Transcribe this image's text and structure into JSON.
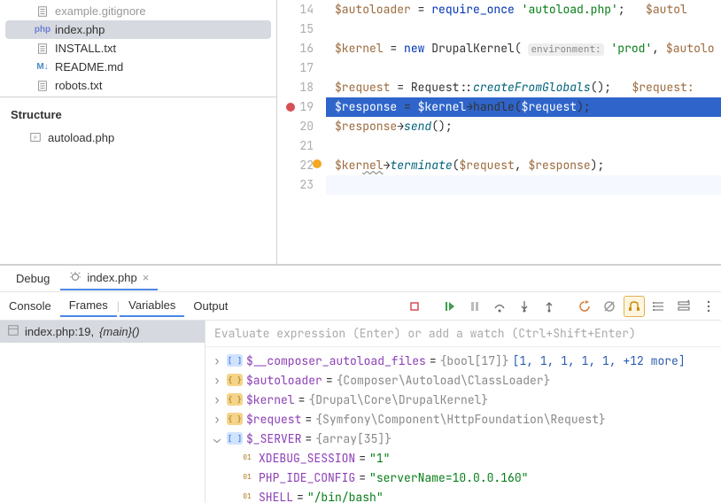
{
  "fileTree": [
    {
      "name": "example.gitignore",
      "type": "txt",
      "dimmed": true
    },
    {
      "name": "index.php",
      "type": "php",
      "selected": true
    },
    {
      "name": "INSTALL.txt",
      "type": "txt"
    },
    {
      "name": "README.md",
      "type": "md"
    },
    {
      "name": "robots.txt",
      "type": "txt"
    }
  ],
  "structure": {
    "title": "Structure",
    "items": [
      "autoload.php"
    ]
  },
  "editor": {
    "startLine": 14,
    "breakpointLine": 19,
    "markerLine": 22,
    "lines": [
      {
        "tokens": [
          [
            "var",
            "$autoloader"
          ],
          [
            "op",
            " = "
          ],
          [
            "kw",
            "require_once"
          ],
          [
            "op",
            " "
          ],
          [
            "str",
            "'autoload.php'"
          ],
          [
            "op",
            ";   "
          ],
          [
            "var",
            "$autol"
          ]
        ]
      },
      {
        "tokens": []
      },
      {
        "tokens": [
          [
            "var",
            "$kernel"
          ],
          [
            "op",
            " = "
          ],
          [
            "kw",
            "new"
          ],
          [
            "op",
            " "
          ],
          [
            "cls",
            "DrupalKernel"
          ],
          [
            "op",
            "( "
          ],
          [
            "hint",
            "environment:"
          ],
          [
            "op",
            " "
          ],
          [
            "str",
            "'prod'"
          ],
          [
            "op",
            ", "
          ],
          [
            "var",
            "$autolo"
          ]
        ]
      },
      {
        "tokens": []
      },
      {
        "tokens": [
          [
            "var",
            "$request"
          ],
          [
            "op",
            " = "
          ],
          [
            "cls",
            "Request"
          ],
          [
            "op",
            "::"
          ],
          [
            "fn",
            "createFromGlobals"
          ],
          [
            "op",
            "();   "
          ],
          [
            "var",
            "$request:"
          ]
        ]
      },
      {
        "highlight": true,
        "tokens": [
          [
            "var",
            "$response"
          ],
          [
            "op",
            " = "
          ],
          [
            "var",
            "$kernel"
          ],
          [
            "op",
            "→"
          ],
          [
            "cls",
            "handle"
          ],
          [
            "op",
            "("
          ],
          [
            "var",
            "$request"
          ],
          [
            "op",
            ");"
          ]
        ]
      },
      {
        "tokens": [
          [
            "var",
            "$response"
          ],
          [
            "op",
            "→"
          ],
          [
            "fn",
            "send"
          ],
          [
            "op",
            "();"
          ]
        ]
      },
      {
        "tokens": []
      },
      {
        "tokens": [
          [
            "var",
            "$ker"
          ],
          [
            "underline",
            "nel"
          ],
          [
            "op",
            "→"
          ],
          [
            "fn",
            "terminate"
          ],
          [
            "op",
            "("
          ],
          [
            "var",
            "$request"
          ],
          [
            "op",
            ", "
          ],
          [
            "var",
            "$response"
          ],
          [
            "op",
            ");"
          ]
        ]
      },
      {
        "current": true,
        "tokens": []
      }
    ]
  },
  "debug": {
    "panelTitle": "Debug",
    "sessionTab": "index.php",
    "subtabs": [
      "Console",
      "Frames",
      "Variables",
      "Output"
    ],
    "activeSubtabs": [
      "Frames",
      "Variables"
    ],
    "frame": {
      "file": "index.php:19,",
      "func": "{main}()"
    },
    "evalPlaceholder": "Evaluate expression (Enter) or add a watch (Ctrl+Shift+Enter)",
    "vars": [
      {
        "kind": "array",
        "badge": "blue",
        "name": "$__composer_autoload_files",
        "value": "{bool[17]}",
        "extra": "[1, 1, 1, 1, 1, +12 more]",
        "arrow": ">"
      },
      {
        "kind": "obj",
        "badge": "yellow",
        "name": "$autoloader",
        "value": "{Composer\\Autoload\\ClassLoader}",
        "arrow": ">"
      },
      {
        "kind": "obj",
        "badge": "yellow",
        "name": "$kernel",
        "value": "{Drupal\\Core\\DrupalKernel}",
        "arrow": ">"
      },
      {
        "kind": "obj",
        "badge": "yellow",
        "name": "$request",
        "value": "{Symfony\\Component\\HttpFoundation\\Request}",
        "arrow": ">"
      },
      {
        "kind": "array",
        "badge": "blue",
        "name": "$_SERVER",
        "value": "{array[35]}",
        "arrow": "v",
        "children": [
          {
            "name": "XDEBUG_SESSION",
            "value": "\"1\""
          },
          {
            "name": "PHP_IDE_CONFIG",
            "value": "\"serverName=10.0.0.160\""
          },
          {
            "name": "SHELL",
            "value": "\"/bin/bash\""
          }
        ]
      }
    ]
  }
}
